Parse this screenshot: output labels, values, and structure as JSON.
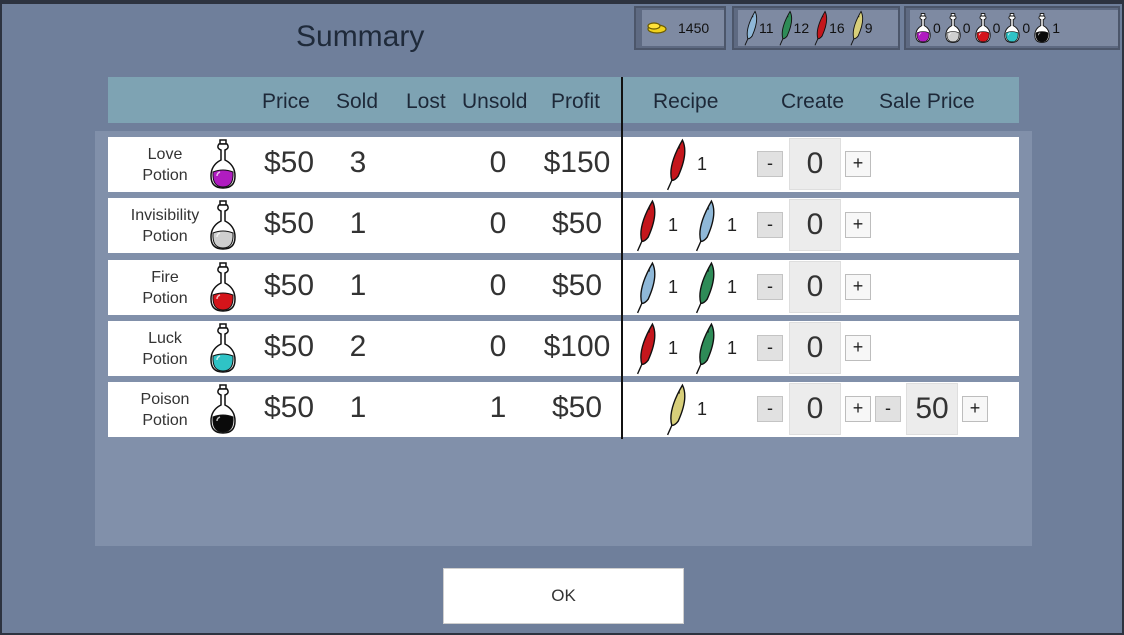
{
  "title": "Summary",
  "resources": {
    "gold": "1450",
    "feathers": [
      {
        "icon": "blue-feather-icon",
        "color": "#8fb8d8",
        "count": "11"
      },
      {
        "icon": "green-feather-icon",
        "color": "#2e8b57",
        "count": "12"
      },
      {
        "icon": "red-feather-icon",
        "color": "#c4161c",
        "count": "16"
      },
      {
        "icon": "yellow-feather-icon",
        "color": "#d8cf7a",
        "count": "9"
      }
    ],
    "potions": [
      {
        "icon": "love-potion-icon",
        "color": "#b01cc0",
        "count": "0"
      },
      {
        "icon": "invisibility-potion-icon",
        "color": "#cfcfcf",
        "count": "0"
      },
      {
        "icon": "fire-potion-icon",
        "color": "#d4141a",
        "count": "0"
      },
      {
        "icon": "luck-potion-icon",
        "color": "#2fc3c6",
        "count": "0"
      },
      {
        "icon": "poison-potion-icon",
        "color": "#0a0a0a",
        "count": "1"
      }
    ]
  },
  "headers": {
    "price": "Price",
    "sold": "Sold",
    "lost": "Lost",
    "unsold": "Unsold",
    "profit": "Profit",
    "recipe": "Recipe",
    "create": "Create",
    "sale_price": "Sale Price"
  },
  "rows": [
    {
      "name1": "Love",
      "name2": "Potion",
      "color": "#b01cc0",
      "price": "$50",
      "sold": "3",
      "lost": "",
      "unsold": "0",
      "profit": "$150",
      "create": "0",
      "minus": "-",
      "plus": "+",
      "recipe": [
        {
          "color": "#c4161c",
          "qty": "1"
        }
      ]
    },
    {
      "name1": "Invisibility",
      "name2": "Potion",
      "color": "#cfcfcf",
      "price": "$50",
      "sold": "1",
      "lost": "",
      "unsold": "0",
      "profit": "$50",
      "create": "0",
      "minus": "-",
      "plus": "+",
      "recipe": [
        {
          "color": "#c4161c",
          "qty": "1"
        },
        {
          "color": "#8fb8d8",
          "qty": "1"
        }
      ]
    },
    {
      "name1": "Fire",
      "name2": "Potion",
      "color": "#d4141a",
      "price": "$50",
      "sold": "1",
      "lost": "",
      "unsold": "0",
      "profit": "$50",
      "create": "0",
      "minus": "-",
      "plus": "+",
      "recipe": [
        {
          "color": "#8fb8d8",
          "qty": "1"
        },
        {
          "color": "#2e8b57",
          "qty": "1"
        }
      ]
    },
    {
      "name1": "Luck",
      "name2": "Potion",
      "color": "#2fc3c6",
      "price": "$50",
      "sold": "2",
      "lost": "",
      "unsold": "0",
      "profit": "$100",
      "create": "0",
      "minus": "-",
      "plus": "+",
      "recipe": [
        {
          "color": "#c4161c",
          "qty": "1"
        },
        {
          "color": "#2e8b57",
          "qty": "1"
        }
      ]
    },
    {
      "name1": "Poison",
      "name2": "Potion",
      "color": "#0a0a0a",
      "price": "$50",
      "sold": "1",
      "lost": "",
      "unsold": "1",
      "profit": "$50",
      "create": "0",
      "minus": "-",
      "plus": "+",
      "recipe": [
        {
          "color": "#d8cf7a",
          "qty": "1"
        }
      ],
      "sale": {
        "minus": "-",
        "value": "50",
        "plus": "+"
      }
    }
  ],
  "ok_label": "OK"
}
